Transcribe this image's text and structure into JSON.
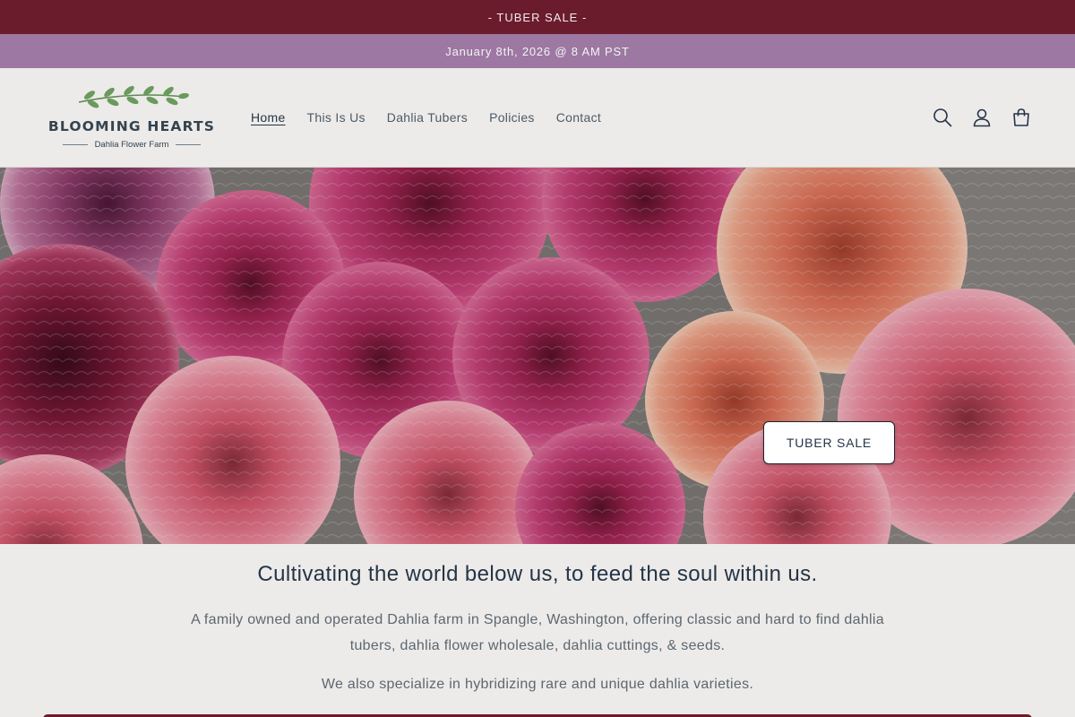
{
  "announcements": {
    "primary": "- TUBER SALE -",
    "secondary": "January 8th, 2026 @ 8 AM PST"
  },
  "brand": {
    "name": "BLOOMING HEARTS",
    "subtitle": "Dahlia Flower Farm"
  },
  "nav": {
    "items": [
      {
        "label": "Home",
        "active": true
      },
      {
        "label": "This Is Us"
      },
      {
        "label": "Dahlia Tubers"
      },
      {
        "label": "Policies"
      },
      {
        "label": "Contact"
      }
    ]
  },
  "header_icons": [
    "search-icon",
    "account-icon",
    "cart-icon"
  ],
  "hero": {
    "button_label": "TUBER SALE"
  },
  "content": {
    "tagline": "Cultivating the world below us, to feed the soul within us.",
    "description": "A family owned and operated Dahlia farm in Spangle, Washington, offering classic and hard to find dahlia tubers, dahlia flower wholesale, dahlia cuttings, & seeds.",
    "description_2": "We also specialize in hybridizing rare and unique dahlia varieties."
  },
  "colors": {
    "announcement_primary": "#6b1c2c",
    "announcement_secondary": "#9c78a2",
    "page_background": "#ecebe9",
    "text_primary": "#253447"
  }
}
